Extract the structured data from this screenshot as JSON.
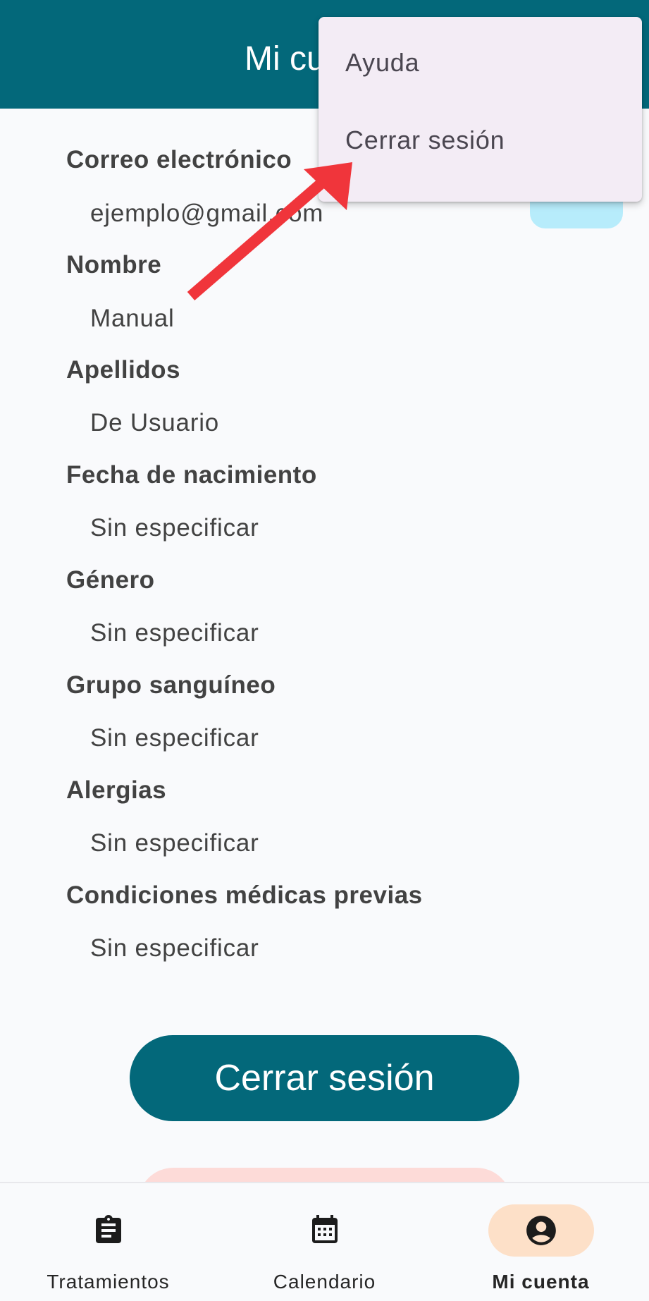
{
  "app_bar": {
    "title": "Mi cuenta"
  },
  "fields": [
    {
      "label": "Correo electrónico",
      "value": "ejemplo@gmail.com"
    },
    {
      "label": "Nombre",
      "value": "Manual"
    },
    {
      "label": "Apellidos",
      "value": "De Usuario"
    },
    {
      "label": "Fecha de nacimiento",
      "value": "Sin especificar"
    },
    {
      "label": "Género",
      "value": "Sin especificar"
    },
    {
      "label": "Grupo sanguíneo",
      "value": "Sin especificar"
    },
    {
      "label": "Alergias",
      "value": "Sin especificar"
    },
    {
      "label": "Condiciones médicas previas",
      "value": "Sin especificar"
    }
  ],
  "logout_button": {
    "label": "Cerrar sesión"
  },
  "overflow_menu": {
    "items": [
      {
        "label": "Ayuda"
      },
      {
        "label": "Cerrar sesión"
      }
    ]
  },
  "bottom_nav": {
    "items": [
      {
        "label": "Tratamientos",
        "icon": "clipboard-icon",
        "active": false
      },
      {
        "label": "Calendario",
        "icon": "calendar-icon",
        "active": false
      },
      {
        "label": "Mi cuenta",
        "icon": "account-circle-icon",
        "active": true
      }
    ]
  },
  "colors": {
    "primary": "#03687a",
    "background": "#f9fafc",
    "menu_background": "#f3ecf5",
    "active_nav_pill": "#fde0c8",
    "annotation_arrow": "#f0353b"
  }
}
